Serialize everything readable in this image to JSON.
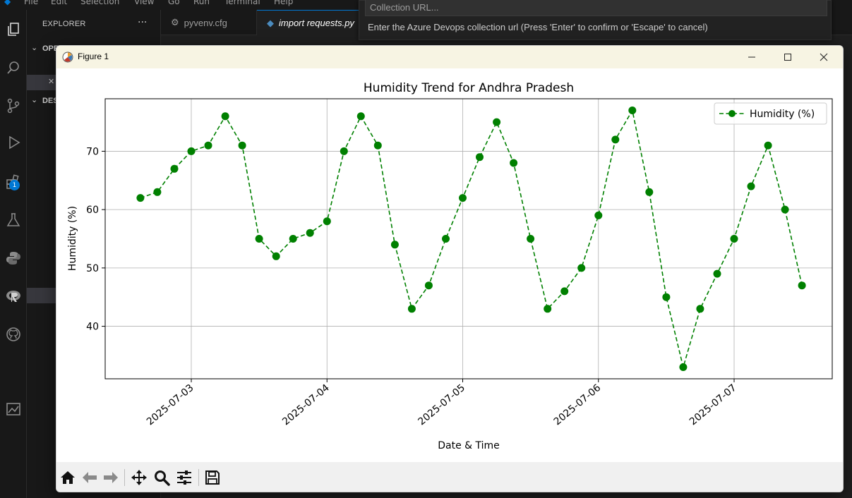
{
  "vscode": {
    "menu": [
      "File",
      "Edit",
      "Selection",
      "View",
      "Go",
      "Run",
      "Terminal",
      "Help"
    ],
    "sidebar": {
      "title": "EXPLORER",
      "more": "···",
      "section_open": "OPEN EDITORS",
      "section_desktop": "DESKTOP"
    },
    "tabs": [
      {
        "label": "pyvenv.cfg",
        "icon": "gear-icon"
      },
      {
        "label": "import requests.py",
        "icon": "python-icon"
      }
    ],
    "extensions_badge": "1",
    "quick_input": {
      "placeholder": "Collection URL...",
      "message": "Enter the Azure Devops collection url (Press 'Enter' to confirm or 'Escape' to cancel)"
    }
  },
  "figure_window": {
    "title": "Figure 1",
    "controls": {
      "minimize": "—",
      "maximize": "☐",
      "close": "✕"
    }
  },
  "chart_data": {
    "type": "line",
    "title": "Humidity Trend for Andhra Pradesh",
    "xlabel": "Date & Time",
    "ylabel": "Humidity (%)",
    "x_tick_labels": [
      "2025-07-03",
      "2025-07-04",
      "2025-07-05",
      "2025-07-06",
      "2025-07-07"
    ],
    "y_ticks": [
      40,
      50,
      60,
      70
    ],
    "ylim": [
      31,
      79
    ],
    "grid": true,
    "legend_position": "top-right",
    "series": [
      {
        "name": "Humidity (%)",
        "color": "#008000",
        "line_style": "dashed",
        "marker": "circle",
        "x": [
          "2025-07-02 15:00",
          "2025-07-02 18:00",
          "2025-07-02 21:00",
          "2025-07-03 00:00",
          "2025-07-03 03:00",
          "2025-07-03 06:00",
          "2025-07-03 09:00",
          "2025-07-03 12:00",
          "2025-07-03 15:00",
          "2025-07-03 18:00",
          "2025-07-03 21:00",
          "2025-07-04 00:00",
          "2025-07-04 03:00",
          "2025-07-04 06:00",
          "2025-07-04 09:00",
          "2025-07-04 12:00",
          "2025-07-04 15:00",
          "2025-07-04 18:00",
          "2025-07-04 21:00",
          "2025-07-05 00:00",
          "2025-07-05 03:00",
          "2025-07-05 06:00",
          "2025-07-05 09:00",
          "2025-07-05 12:00",
          "2025-07-05 15:00",
          "2025-07-05 18:00",
          "2025-07-05 21:00",
          "2025-07-06 00:00",
          "2025-07-06 03:00",
          "2025-07-06 06:00",
          "2025-07-06 09:00",
          "2025-07-06 12:00",
          "2025-07-06 15:00",
          "2025-07-06 18:00",
          "2025-07-06 21:00",
          "2025-07-07 00:00",
          "2025-07-07 03:00",
          "2025-07-07 06:00",
          "2025-07-07 09:00",
          "2025-07-07 12:00"
        ],
        "values": [
          62,
          63,
          67,
          70,
          71,
          76,
          71,
          55,
          52,
          55,
          56,
          58,
          70,
          76,
          71,
          54,
          43,
          47,
          55,
          62,
          69,
          75,
          68,
          55,
          43,
          46,
          50,
          59,
          72,
          77,
          63,
          45,
          33,
          43,
          49,
          55,
          64,
          71,
          60,
          47
        ]
      }
    ]
  }
}
